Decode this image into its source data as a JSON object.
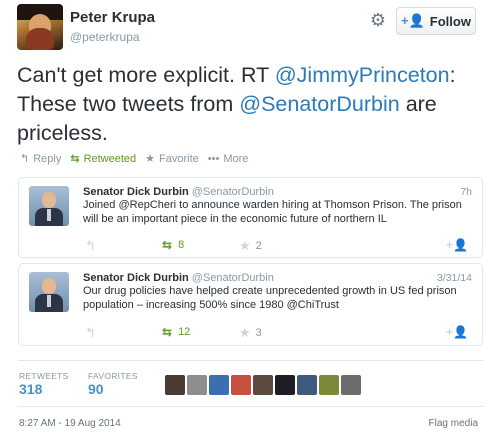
{
  "header": {
    "display_name": "Peter Krupa",
    "handle": "@peterkrupa",
    "follow_label": "Follow"
  },
  "tweet": {
    "text_1": "Can't get more explicit. RT ",
    "mention_1": "@JimmyPrinceton",
    "text_2": ": These two tweets from ",
    "mention_2": "@SenatorDurbin",
    "text_3": " are priceless."
  },
  "actions": {
    "reply": "Reply",
    "retweeted": "Retweeted",
    "favorite": "Favorite",
    "more": "More"
  },
  "embedded_tweets": [
    {
      "name": "Senator Dick Durbin",
      "handle": "@SenatorDurbin",
      "time": "7h",
      "text": "Joined @RepCheri  to announce warden hiring at Thomson Prison. The prison will be an important piece in the economic future of northern IL",
      "retweets": "8",
      "favorites": "2"
    },
    {
      "name": "Senator Dick Durbin",
      "handle": "@SenatorDurbin",
      "time": "3/31/14",
      "text": "Our drug policies have helped create unprecedented growth in US fed prison population – increasing 500% since 1980 @ChiTrust",
      "retweets": "12",
      "favorites": "3"
    }
  ],
  "stats": {
    "retweets_label": "RETWEETS",
    "retweets_count": "318",
    "favorites_label": "FAVORITES",
    "favorites_count": "90"
  },
  "footer": {
    "timestamp": "8:27 AM - 19 Aug 2014",
    "flag": "Flag media"
  },
  "colors": {
    "link": "#2b7bb9",
    "retweet": "#609928",
    "stat_number": "#4a90c9"
  }
}
